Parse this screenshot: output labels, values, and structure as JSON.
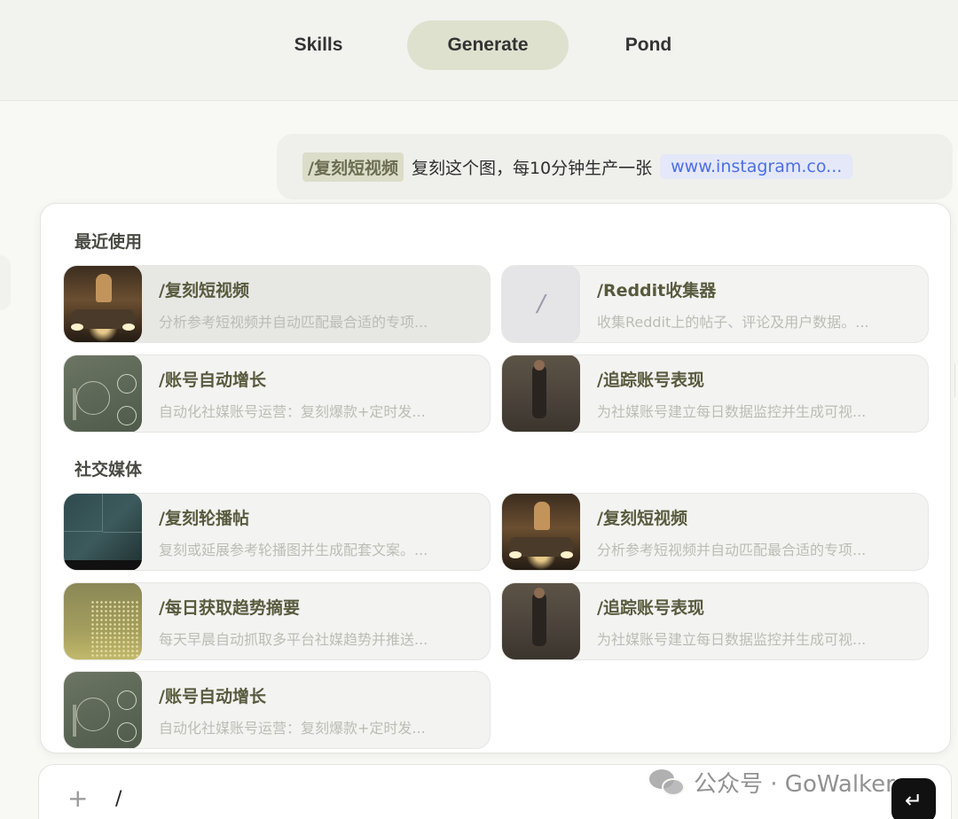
{
  "tabs": [
    {
      "label": "Skills"
    },
    {
      "label": "Generate"
    },
    {
      "label": "Pond"
    }
  ],
  "user_message": {
    "command": "/复刻短视频",
    "text": "复刻这个图，每10分钟生产一张",
    "link": "www.instagram.co..."
  },
  "sections": {
    "recent": {
      "title": "最近使用",
      "cards": [
        {
          "title": "/复刻短视频",
          "desc": "分析参考短视频并自动匹配最合适的专项...",
          "thumb": "video-thumbnail"
        },
        {
          "title": "/Reddit收集器",
          "desc": "收集Reddit上的帖子、评论及用户数据。...",
          "thumb": "slash-icon",
          "glyph": "/"
        },
        {
          "title": "/账号自动增长",
          "desc": "自动化社媒账号运营：复刻爆款+定时发...",
          "thumb": "growth-thumbnail"
        },
        {
          "title": "/追踪账号表现",
          "desc": "为社媒账号建立每日数据监控并生成可视...",
          "thumb": "track-thumbnail"
        }
      ]
    },
    "social": {
      "title": "社交媒体",
      "cards": [
        {
          "title": "/复刻轮播帖",
          "desc": "复刻或延展参考轮播图并生成配套文案。...",
          "thumb": "carousel-thumbnail"
        },
        {
          "title": "/复刻短视频",
          "desc": "分析参考短视频并自动匹配最合适的专项...",
          "thumb": "video-thumbnail"
        },
        {
          "title": "/每日获取趋势摘要",
          "desc": "每天早晨自动抓取多平台社媒趋势并推送...",
          "thumb": "trend-thumbnail"
        },
        {
          "title": "/追踪账号表现",
          "desc": "为社媒账号建立每日数据监控并生成可视...",
          "thumb": "track-thumbnail"
        },
        {
          "title": "/账号自动增长",
          "desc": "自动化社媒账号运营：复刻爆款+定时发...",
          "thumb": "growth-thumbnail"
        }
      ]
    }
  },
  "input": {
    "value": "/",
    "plus_glyph": "+",
    "send_glyph": "↵"
  },
  "watermark": {
    "text": "公众号 · GoWalker"
  },
  "colors": {
    "active_tab": "#dfe1cf",
    "command_chip": "#dcddc9",
    "link": "#4d6fe3",
    "card_title": "#585a3e"
  }
}
